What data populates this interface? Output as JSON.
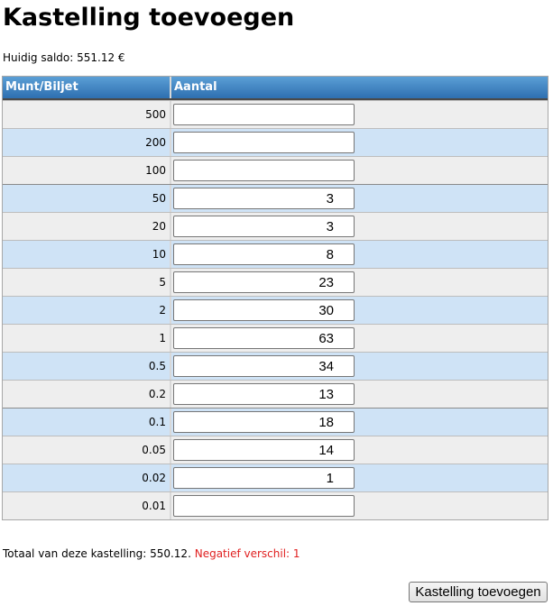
{
  "page": {
    "title": "Kastelling toevoegen",
    "balance_text": "Huidig saldo: 551.12 €"
  },
  "table": {
    "headers": {
      "denomination": "Munt/Biljet",
      "count": "Aantal"
    },
    "rows": [
      {
        "denomination": "500",
        "count": ""
      },
      {
        "denomination": "200",
        "count": ""
      },
      {
        "denomination": "100",
        "count": ""
      },
      {
        "denomination": "50",
        "count": "3"
      },
      {
        "denomination": "20",
        "count": "3"
      },
      {
        "denomination": "10",
        "count": "8"
      },
      {
        "denomination": "5",
        "count": "23"
      },
      {
        "denomination": "2",
        "count": "30"
      },
      {
        "denomination": "1",
        "count": "63"
      },
      {
        "denomination": "0.5",
        "count": "34"
      },
      {
        "denomination": "0.2",
        "count": "13"
      },
      {
        "denomination": "0.1",
        "count": "18"
      },
      {
        "denomination": "0.05",
        "count": "14"
      },
      {
        "denomination": "0.02",
        "count": "1"
      },
      {
        "denomination": "0.01",
        "count": ""
      }
    ]
  },
  "footer": {
    "total_text": "Totaal van deze kastelling: 550.12.",
    "negative_diff_text": "Negatief verschil: 1",
    "submit_label": "Kastelling toevoegen"
  },
  "colors": {
    "header_gradient_top": "#5b9fd6",
    "header_gradient_bottom": "#2e6fb0",
    "row_odd": "#eeeeee",
    "row_even": "#cfe3f6",
    "negative": "#e02020"
  }
}
